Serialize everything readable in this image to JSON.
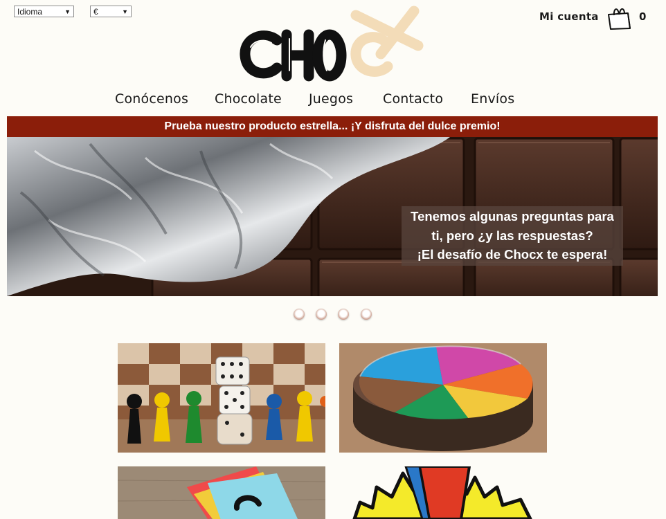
{
  "header": {
    "language_select": {
      "value": "Idioma"
    },
    "currency_select": {
      "value": "€"
    },
    "account_label": "Mi cuenta",
    "cart_count": "0",
    "logo": {
      "text": "CHOCX",
      "primary_color": "#111111",
      "accent_color": "#f3dcb8"
    }
  },
  "nav": {
    "items": [
      {
        "label": "Conócenos"
      },
      {
        "label": "Chocolate"
      },
      {
        "label": "Juegos"
      },
      {
        "label": "Contacto"
      },
      {
        "label": "Envíos"
      }
    ]
  },
  "promo": {
    "text": "Prueba nuestro producto estrella... ¡Y disfruta del dulce premio!",
    "color": "#8b1e0a"
  },
  "slider": {
    "caption": {
      "line1": "Tenemos algunas preguntas para",
      "line2": "ti, pero ¿y las respuestas?",
      "line3": "¡El desafío de Chocx te espera!"
    },
    "dots_count": 4
  },
  "tiles": [
    {
      "name": "board-game-pieces-image"
    },
    {
      "name": "trivial-cheese-image"
    },
    {
      "name": "question-notes-image"
    },
    {
      "name": "comic-burst-image"
    }
  ]
}
